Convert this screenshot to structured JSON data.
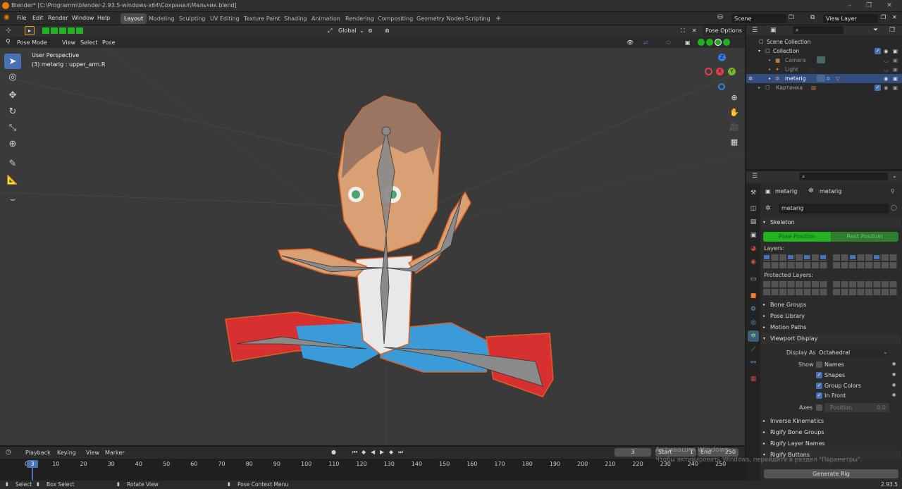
{
  "title_bar": {
    "title": "Blender* [C:\\Programm\\blender-2.93.5-windows-x64\\Сохранал\\Мальчик.blend]"
  },
  "menu": {
    "items": [
      "File",
      "Edit",
      "Render",
      "Window",
      "Help"
    ],
    "workspaces": [
      "Layout",
      "Modeling",
      "Sculpting",
      "UV Editing",
      "Texture Paint",
      "Shading",
      "Animation",
      "Rendering",
      "Compositing",
      "Geometry Nodes",
      "Scripting"
    ],
    "active_workspace": "Layout",
    "add_tab": "+",
    "scene": "Scene",
    "view_layer": "View Layer"
  },
  "viewport": {
    "mode": "Pose Mode",
    "menus": [
      "View",
      "Select",
      "Pose"
    ],
    "orientation": "Global",
    "pose_options": "Pose Options",
    "overlay_title": "User Perspective",
    "overlay_subtitle": "(3) metarig : upper_arm.R",
    "gizmo": {
      "z": "Z",
      "y": "Y",
      "x": "X"
    }
  },
  "outliner": {
    "search_placeholder": "",
    "rows": [
      {
        "label": "Scene Collection"
      },
      {
        "label": "Collection"
      },
      {
        "label": "Camera"
      },
      {
        "label": "Light"
      },
      {
        "label": "metarig"
      },
      {
        "label": "Картинка"
      }
    ]
  },
  "properties": {
    "breadcrumb_a": "metarig",
    "breadcrumb_b": "metarig",
    "data_name": "metarig",
    "skeleton": "Skeleton",
    "pose_position": "Pose Position",
    "rest_position": "Rest Position",
    "layers": "Layers:",
    "protected_layers": "Protected Layers:",
    "sections": [
      "Bone Groups",
      "Pose Library",
      "Motion Paths"
    ],
    "viewport_display": "Viewport Display",
    "display_as_label": "Display As",
    "display_as": "Octahedral",
    "show_label": "Show",
    "show_items": [
      {
        "label": "Names",
        "checked": false
      },
      {
        "label": "Shapes",
        "checked": true
      },
      {
        "label": "Group Colors",
        "checked": true
      },
      {
        "label": "In Front",
        "checked": true
      }
    ],
    "axes_label": "Axes",
    "position_label": "Position",
    "position_value": "0.0",
    "sections_lower": [
      "Inverse Kinematics",
      "Rigify Bone Groups",
      "Rigify Layer Names",
      "Rigify Buttons"
    ],
    "generate_rig": "Generate Rig"
  },
  "timeline": {
    "menus": [
      "Playback",
      "Keying",
      "View",
      "Marker"
    ],
    "current_frame": "3",
    "start_label": "Start",
    "start_value": "1",
    "end_label": "End",
    "end_value": "250",
    "ticks": [
      "0",
      "10",
      "20",
      "30",
      "40",
      "50",
      "60",
      "70",
      "80",
      "90",
      "100",
      "110",
      "120",
      "130",
      "140",
      "150",
      "160",
      "170",
      "180",
      "190",
      "200",
      "210",
      "220",
      "230",
      "240",
      "250"
    ]
  },
  "watermark": {
    "line1": "Активация Windows",
    "line2": "Чтобы активировать Windows, перейдите в раздел \"Параметры\"."
  },
  "status": {
    "select": "Select",
    "box_select": "Box Select",
    "rotate_view": "Rotate View",
    "context_menu": "Pose Context Menu",
    "version": "2.93.5"
  },
  "colors": {
    "accent": "#4772b3",
    "pose_green": "#22b322",
    "orange": "#e87d0d"
  }
}
